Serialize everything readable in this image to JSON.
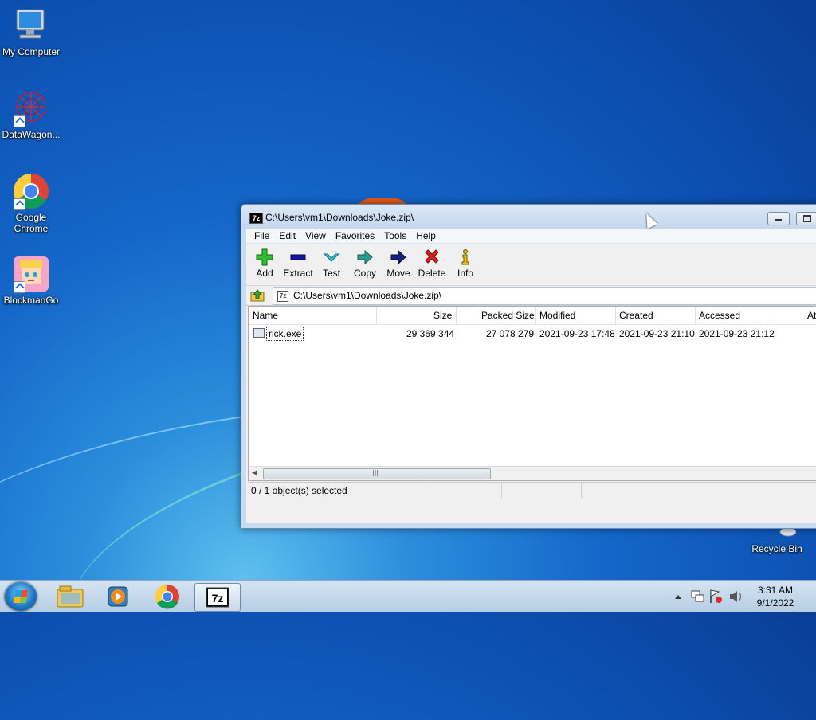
{
  "desktop": {
    "icons": [
      {
        "label": "My Computer",
        "icon": "computer-icon"
      },
      {
        "label": "DataWagon...",
        "icon": "datawagon-icon"
      },
      {
        "label": "Google Chrome",
        "icon": "chrome-icon"
      },
      {
        "label": "BlockmanGo",
        "icon": "blockmango-icon"
      },
      {
        "label": "Recycle Bin",
        "icon": "recycle-bin-icon"
      }
    ]
  },
  "window": {
    "app_icon_text": "7z",
    "title": "C:\\Users\\vm1\\Downloads\\Joke.zip\\",
    "menu": [
      "File",
      "Edit",
      "View",
      "Favorites",
      "Tools",
      "Help"
    ],
    "toolbar": [
      {
        "label": "Add",
        "icon": "add-icon"
      },
      {
        "label": "Extract",
        "icon": "extract-icon"
      },
      {
        "label": "Test",
        "icon": "test-icon"
      },
      {
        "label": "Copy",
        "icon": "copy-icon"
      },
      {
        "label": "Move",
        "icon": "move-icon"
      },
      {
        "label": "Delete",
        "icon": "delete-icon"
      },
      {
        "label": "Info",
        "icon": "info-icon"
      }
    ],
    "address": "C:\\Users\\vm1\\Downloads\\Joke.zip\\",
    "columns": [
      "Name",
      "Size",
      "Packed Size",
      "Modified",
      "Created",
      "Accessed",
      "At"
    ],
    "rows": [
      {
        "name": "rick.exe",
        "size": "29 369 344",
        "packed_size": "27 078 279",
        "modified": "2021-09-23 17:48",
        "created": "2021-09-23 21:10",
        "accessed": "2021-09-23 21:12"
      }
    ],
    "status": "0 / 1 object(s) selected"
  },
  "taskbar": {
    "pinned": [
      "explorer-icon",
      "media-player-icon",
      "chrome-icon",
      "7zip-icon"
    ],
    "active_app_text": "7z",
    "time": "3:31 AM",
    "date": "9/1/2022"
  },
  "colors": {
    "accent": "#1466c8",
    "taskbar": "#c4d7ec"
  }
}
